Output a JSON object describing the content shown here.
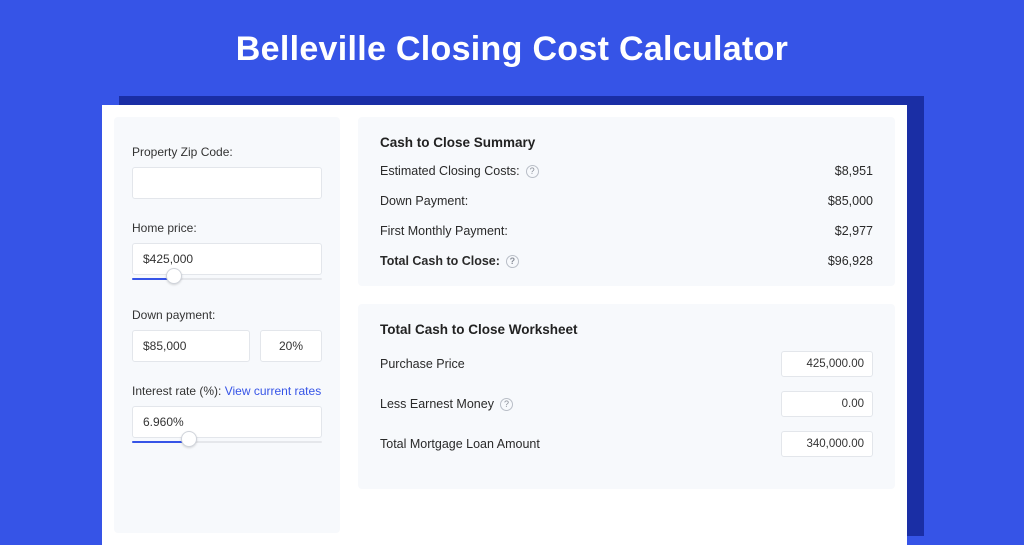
{
  "title": "Belleville Closing Cost Calculator",
  "left": {
    "zip_label": "Property Zip Code:",
    "zip_value": "",
    "home_price_label": "Home price:",
    "home_price_value": "$425,000",
    "home_price_slider_pct": 22,
    "down_payment_label": "Down payment:",
    "down_payment_value": "$85,000",
    "down_payment_pct": "20%",
    "interest_label_prefix": "Interest rate (%): ",
    "interest_link": "View current rates",
    "interest_value": "6.960%",
    "interest_slider_pct": 30
  },
  "summary": {
    "title": "Cash to Close Summary",
    "rows": [
      {
        "label": "Estimated Closing Costs:",
        "help": true,
        "value": "$8,951"
      },
      {
        "label": "Down Payment:",
        "help": false,
        "value": "$85,000"
      },
      {
        "label": "First Monthly Payment:",
        "help": false,
        "value": "$2,977"
      }
    ],
    "total_label": "Total Cash to Close:",
    "total_value": "$96,928"
  },
  "worksheet": {
    "title": "Total Cash to Close Worksheet",
    "rows": [
      {
        "label": "Purchase Price",
        "help": false,
        "value": "425,000.00"
      },
      {
        "label": "Less Earnest Money",
        "help": true,
        "value": "0.00"
      },
      {
        "label": "Total Mortgage Loan Amount",
        "help": false,
        "value": "340,000.00"
      }
    ]
  }
}
